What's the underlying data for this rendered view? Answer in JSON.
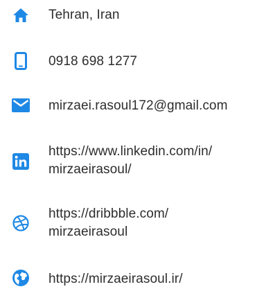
{
  "colors": {
    "accent": "#1e88e5",
    "text": "#2d2d2d"
  },
  "contacts": [
    {
      "icon": "home-icon",
      "lines": [
        "Tehran, Iran"
      ]
    },
    {
      "icon": "phone-icon",
      "lines": [
        "0918 698 1277"
      ]
    },
    {
      "icon": "email-icon",
      "lines": [
        "mirzaei.rasoul172@gmail.com"
      ]
    },
    {
      "icon": "linkedin-icon",
      "lines": [
        "https://www.linkedin.com/in/",
        "mirzaeirasoul/"
      ]
    },
    {
      "icon": "dribbble-icon",
      "lines": [
        "https://dribbble.com/",
        "mirzaeirasoul"
      ]
    },
    {
      "icon": "website-icon",
      "lines": [
        "https://mirzaeirasoul.ir/"
      ]
    }
  ]
}
